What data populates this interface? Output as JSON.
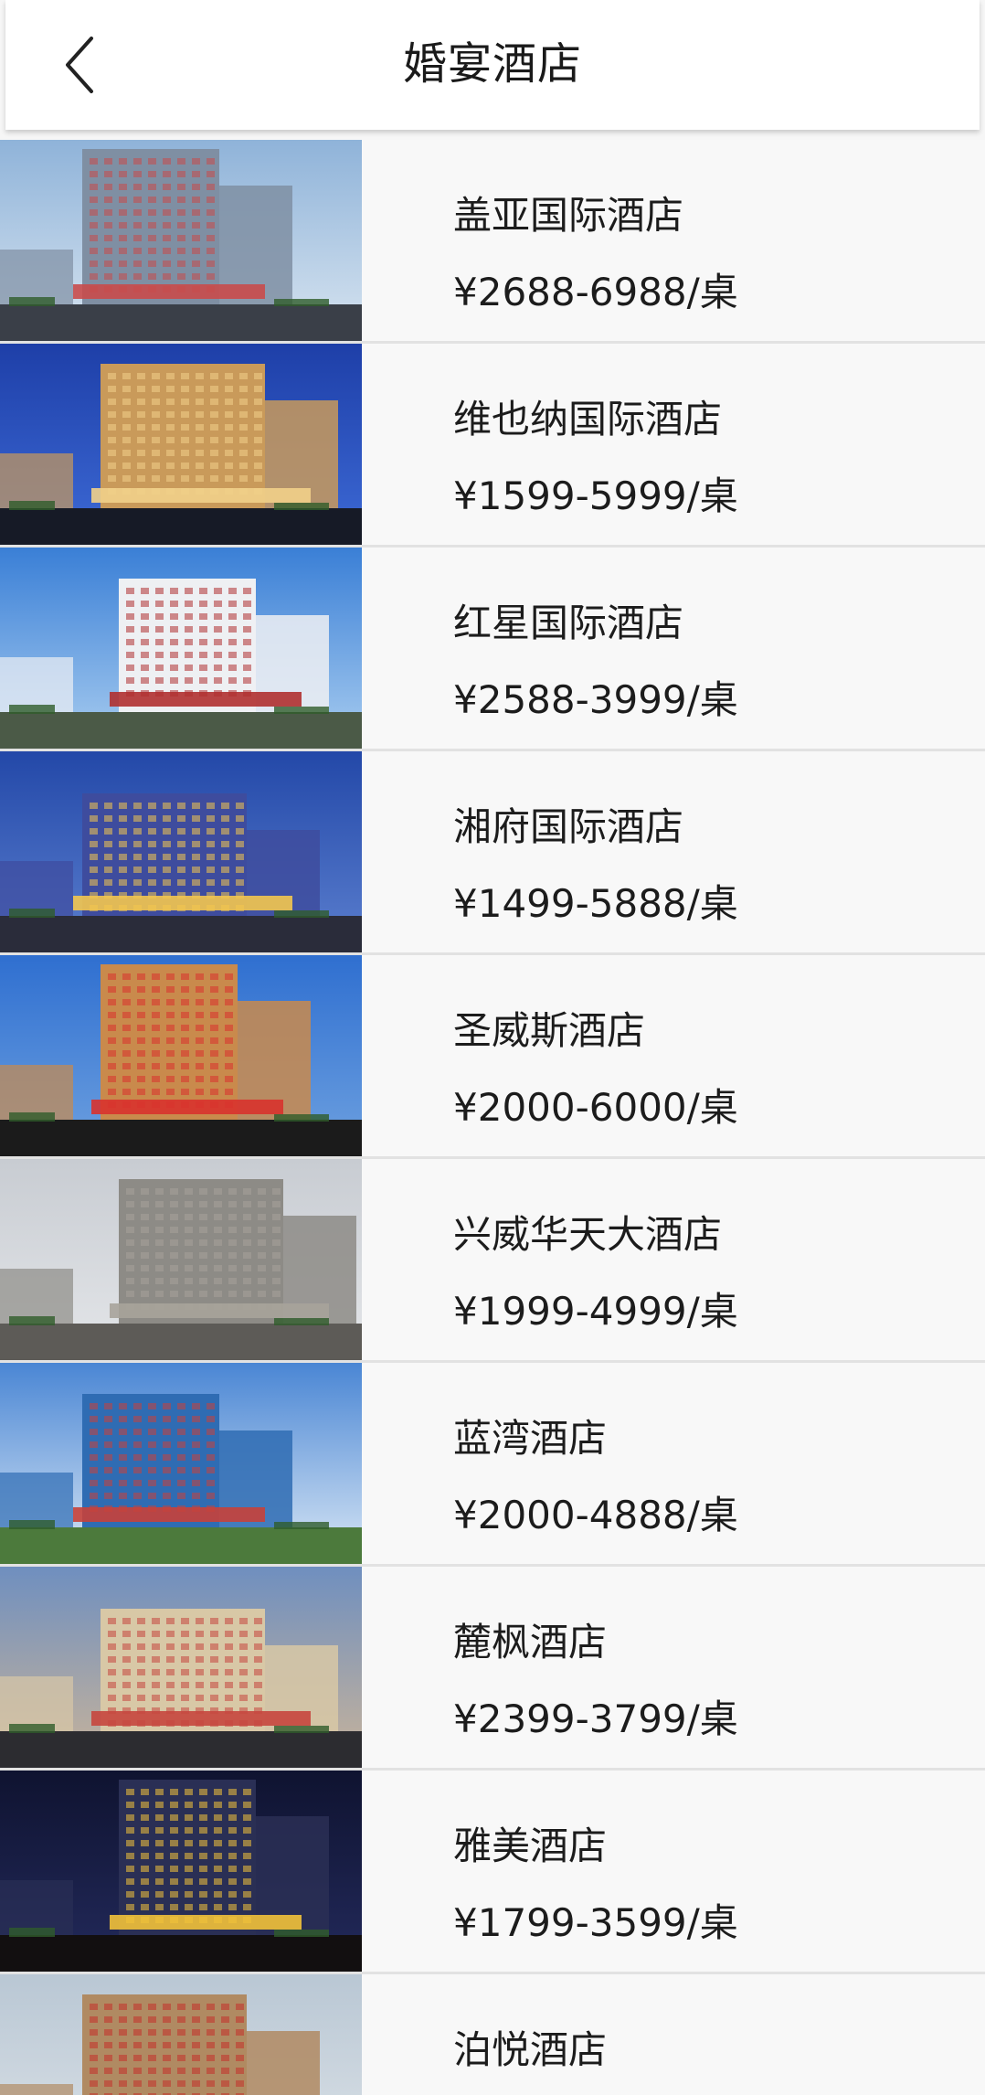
{
  "header": {
    "title": "婚宴酒店",
    "back_icon": "chevron-left-icon"
  },
  "hotels": [
    {
      "name": "盖亚国际酒店",
      "price": "¥2688-6988/桌",
      "sky": "#8fb3d9",
      "sky2": "#d7e4f0",
      "building": "#7f8fa3",
      "accent": "#c94b4b",
      "ground": "#3a3f48"
    },
    {
      "name": "维也纳国际酒店",
      "price": "¥1599-5999/桌",
      "sky": "#1e3fa8",
      "sky2": "#3d6ad6",
      "building": "#c99a5a",
      "accent": "#f1d08a",
      "ground": "#161a26"
    },
    {
      "name": "红星国际酒店",
      "price": "¥2588-3999/桌",
      "sky": "#3a7fd6",
      "sky2": "#a9cdf0",
      "building": "#eef0f3",
      "accent": "#b03030",
      "ground": "#4b5a47"
    },
    {
      "name": "湘府国际酒店",
      "price": "¥1499-5888/桌",
      "sky": "#2348a8",
      "sky2": "#5b7fcf",
      "building": "#3e4c9e",
      "accent": "#f3c64f",
      "ground": "#2a2c3a"
    },
    {
      "name": "圣威斯酒店",
      "price": "¥2000-6000/桌",
      "sky": "#2f6fd0",
      "sky2": "#6ea1e0",
      "building": "#c98a4c",
      "accent": "#d8322e",
      "ground": "#1b1b1b"
    },
    {
      "name": "兴威华天大酒店",
      "price": "¥1999-4999/桌",
      "sky": "#c8ccd2",
      "sky2": "#e4e6e9",
      "building": "#8d8b86",
      "accent": "#a7a39a",
      "ground": "#5d5b57"
    },
    {
      "name": "蓝湾酒店",
      "price": "¥2000-4888/桌",
      "sky": "#4a86d4",
      "sky2": "#d9e7f5",
      "building": "#2f6cb3",
      "accent": "#c8413a",
      "ground": "#4c7a3c"
    },
    {
      "name": "麓枫酒店",
      "price": "¥2399-3799/桌",
      "sky": "#6f8fbf",
      "sky2": "#c9b49a",
      "building": "#d8c8a6",
      "accent": "#c6463e",
      "ground": "#2c2c30"
    },
    {
      "name": "雅美酒店",
      "price": "¥1799-3599/桌",
      "sky": "#0f1330",
      "sky2": "#232a5c",
      "building": "#2a2f55",
      "accent": "#f2c23a",
      "ground": "#120f10"
    },
    {
      "name": "泊悦酒店",
      "price": "",
      "sky": "#b9c7d4",
      "sky2": "#dde3e8",
      "building": "#b08a62",
      "accent": "#c52f2a",
      "ground": "#7b2a22"
    }
  ]
}
